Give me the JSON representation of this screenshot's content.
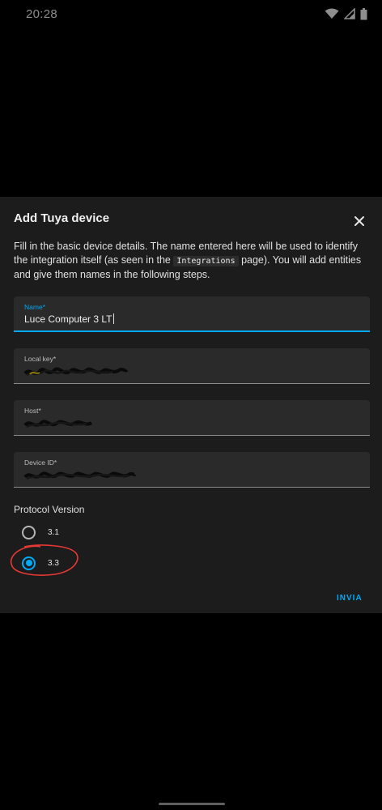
{
  "status_bar": {
    "time": "20:28",
    "icons": [
      "wifi-icon",
      "signal-icon",
      "battery-icon"
    ]
  },
  "dialog": {
    "title": "Add Tuya device",
    "close_icon": "close-icon",
    "description_part1": "Fill in the basic device details. The name entered here will be used to identify the integration itself (as seen in the ",
    "description_code": "Integrations",
    "description_part2": " page). You will add entities and give them names in the following steps.",
    "fields": [
      {
        "label": "Name*",
        "value": "Luce Computer 3 LT",
        "focused": true
      },
      {
        "label": "Local key*",
        "value": "",
        "redacted": true
      },
      {
        "label": "Host*",
        "value": "",
        "redacted": true
      },
      {
        "label": "Device ID*",
        "value": "",
        "redacted": true
      }
    ],
    "protocol": {
      "label": "Protocol Version",
      "options": [
        {
          "label": "3.1",
          "checked": false
        },
        {
          "label": "3.3",
          "checked": true
        }
      ]
    },
    "submit_label": "INVIA"
  },
  "colors": {
    "accent": "#03a9f4",
    "dialog_bg": "#1c1c1c",
    "field_bg": "#2a2a2a",
    "annotation": "#e53935"
  }
}
